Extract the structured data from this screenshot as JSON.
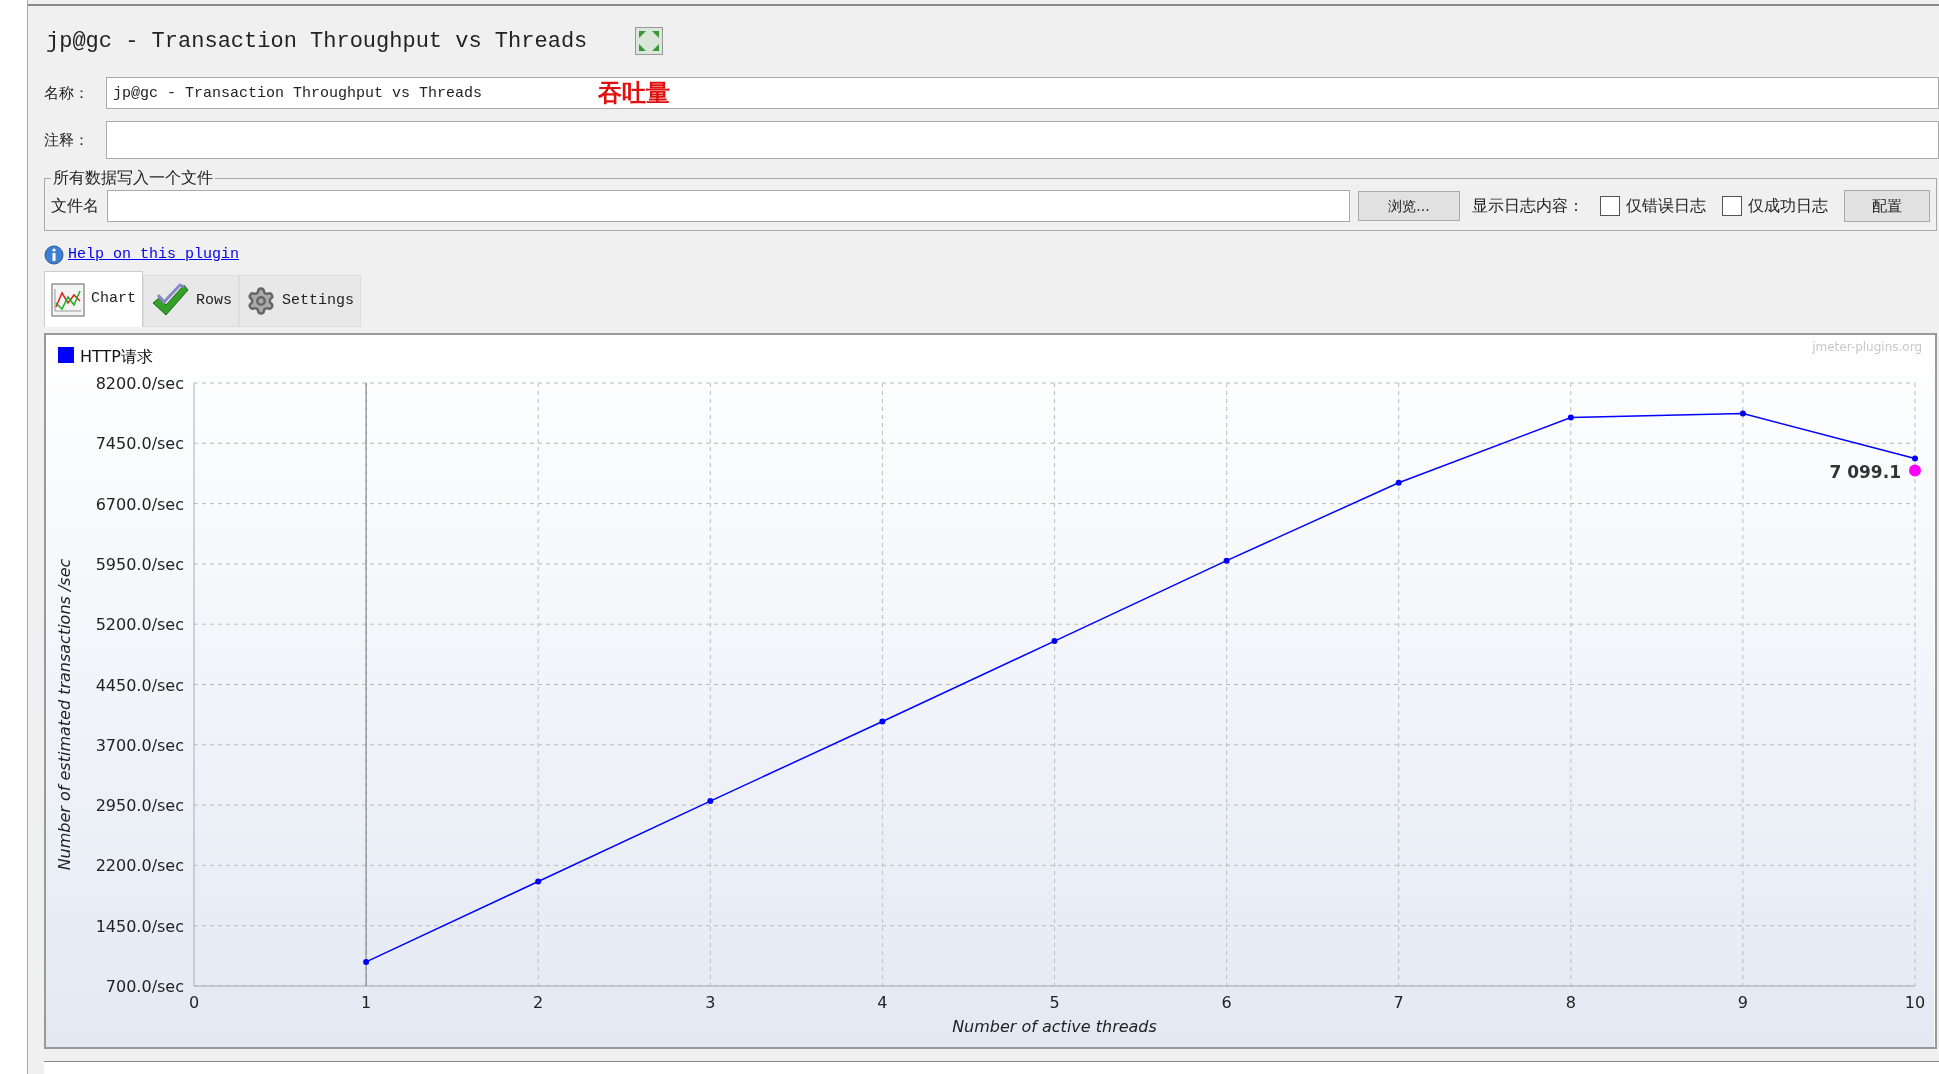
{
  "title": "jp@gc - Transaction Throughput vs Threads",
  "name_field": {
    "label": "名称：",
    "value": "jp@gc - Transaction Throughput vs Threads",
    "annotation": "吞吐量"
  },
  "comment_field": {
    "label": "注释："
  },
  "file_group": {
    "legend": "所有数据写入一个文件",
    "filename_label": "文件名",
    "browse_button": "浏览...",
    "log_label": "显示日志内容：",
    "config_button": "配置",
    "checkboxes": [
      {
        "label": "仅错误日志",
        "checked": false
      },
      {
        "label": "仅成功日志",
        "checked": false
      }
    ]
  },
  "help_link": "Help on this plugin",
  "tabs": [
    {
      "label": "Chart",
      "selected": true
    },
    {
      "label": "Rows",
      "selected": false
    },
    {
      "label": "Settings",
      "selected": false
    }
  ],
  "chart": {
    "watermark": "jmeter-plugins.org",
    "current_value": "7 099.1",
    "chart_data": {
      "type": "line",
      "grid": true,
      "ref_lines": [
        {
          "axis": "x",
          "value": 1
        }
      ],
      "xlabel": "Number of active threads",
      "ylabel": "Number of estimated transactions /sec",
      "x": [
        1,
        2,
        3,
        4,
        5,
        6,
        7,
        8,
        9,
        10
      ],
      "series": [
        {
          "name": "HTTP请求",
          "color": "#0000ff",
          "marker": true,
          "values": [
            1000,
            2000,
            3000,
            3990,
            4990,
            5990,
            6960,
            7770,
            7820,
            7260
          ]
        }
      ],
      "xlim": [
        0,
        10
      ],
      "ylim": [
        700,
        8200
      ],
      "xticks": [
        0,
        1,
        2,
        3,
        4,
        5,
        6,
        7,
        8,
        9,
        10
      ],
      "yticks": [
        {
          "value": 700,
          "label": "700.0/sec"
        },
        {
          "value": 1450,
          "label": "1450.0/sec"
        },
        {
          "value": 2200,
          "label": "2200.0/sec"
        },
        {
          "value": 2950,
          "label": "2950.0/sec"
        },
        {
          "value": 3700,
          "label": "3700.0/sec"
        },
        {
          "value": 4450,
          "label": "4450.0/sec"
        },
        {
          "value": 5200,
          "label": "5200.0/sec"
        },
        {
          "value": 5950,
          "label": "5950.0/sec"
        },
        {
          "value": 6700,
          "label": "6700.0/sec"
        },
        {
          "value": 7450,
          "label": "7450.0/sec"
        },
        {
          "value": 8200,
          "label": "8200.0/sec"
        }
      ]
    }
  }
}
